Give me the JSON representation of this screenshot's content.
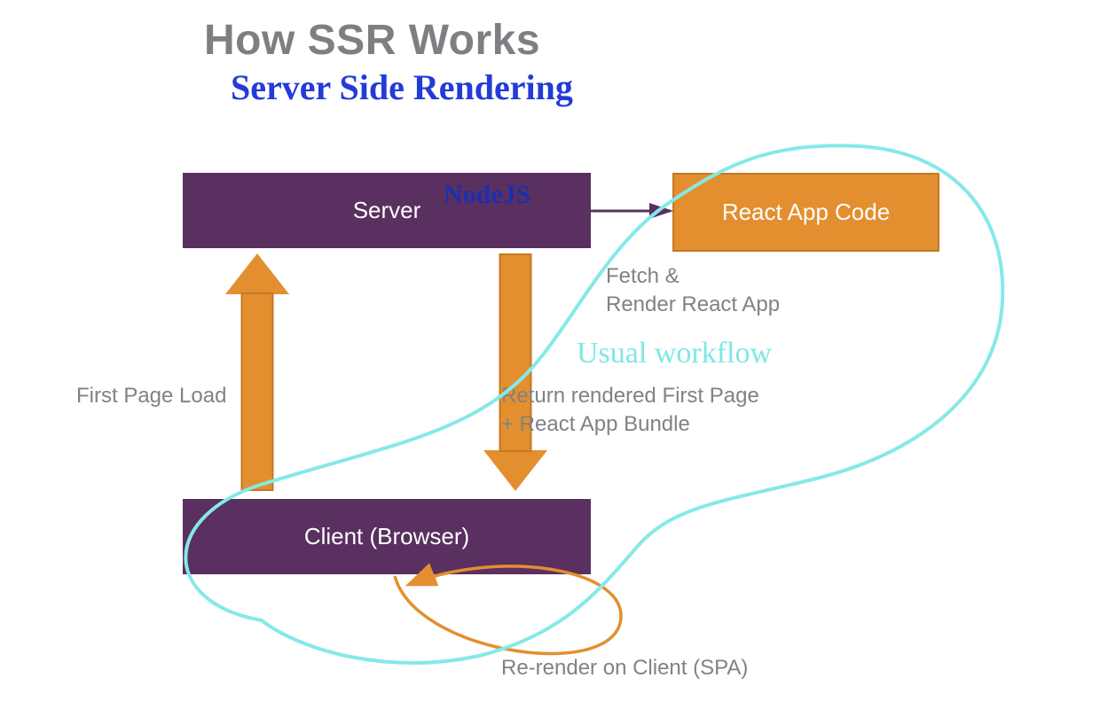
{
  "title": "How SSR Works",
  "subtitle_annotation": "Server Side Rendering",
  "nodes": {
    "server": "Server",
    "client": "Client (Browser)",
    "react_app": "React App Code"
  },
  "annotations": {
    "nodejs": "NodeJS",
    "usual_workflow": "Usual workflow"
  },
  "edges": {
    "server_react": "Fetch &\nRender React App",
    "client_to_server": "First Page Load",
    "server_to_client": "Return rendered First Page\n+ React App Bundle",
    "client_self_loop": "Re-render on Client (SPA)"
  },
  "colors": {
    "title_gray": "#7d7f82",
    "box_purple": "#59305f",
    "box_orange": "#e38f2f",
    "orange_border": "#c47821",
    "label_gray": "#808285",
    "blue_ink": "#233bd8",
    "cyan_ink": "#7de8e6"
  }
}
